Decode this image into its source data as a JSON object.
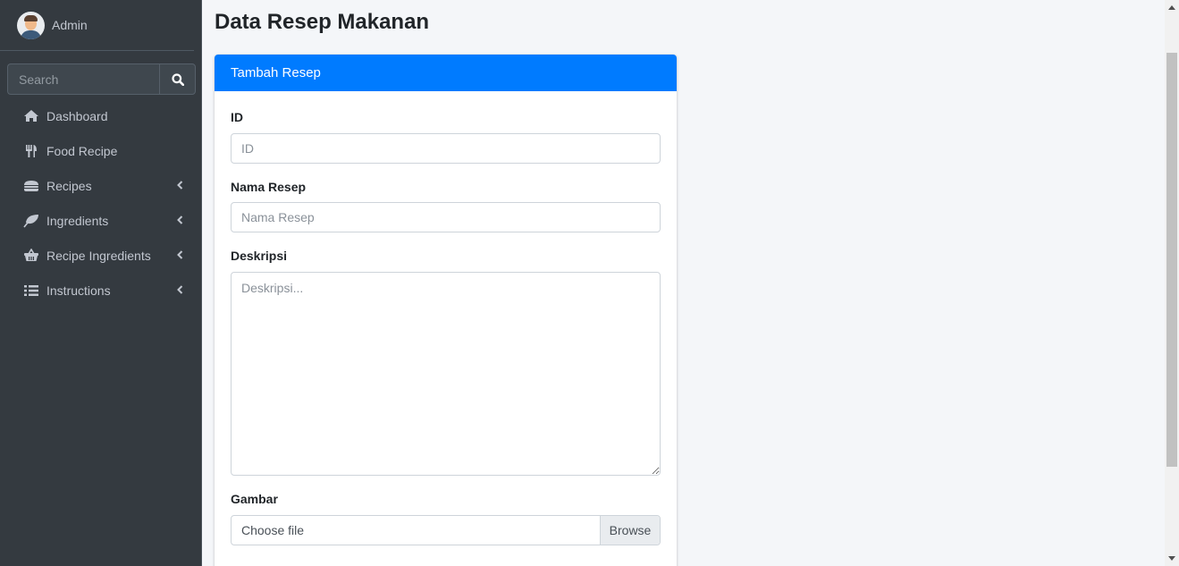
{
  "user": {
    "name": "Admin"
  },
  "search": {
    "placeholder": "Search"
  },
  "nav": [
    {
      "label": "Dashboard",
      "icon": "home-icon",
      "has_submenu": false
    },
    {
      "label": "Food Recipe",
      "icon": "utensils-icon",
      "has_submenu": false
    },
    {
      "label": "Recipes",
      "icon": "hamburger-icon",
      "has_submenu": true
    },
    {
      "label": "Ingredients",
      "icon": "leaf-icon",
      "has_submenu": true
    },
    {
      "label": "Recipe Ingredients",
      "icon": "basket-icon",
      "has_submenu": true
    },
    {
      "label": "Instructions",
      "icon": "list-icon",
      "has_submenu": true
    }
  ],
  "page": {
    "title": "Data Resep Makanan"
  },
  "card": {
    "header": "Tambah Resep"
  },
  "form": {
    "id_label": "ID",
    "id_placeholder": "ID",
    "nama_label": "Nama Resep",
    "nama_placeholder": "Nama Resep",
    "deskripsi_label": "Deskripsi",
    "deskripsi_placeholder": "Deskripsi...",
    "gambar_label": "Gambar",
    "file_label": "Choose file",
    "browse_label": "Browse"
  },
  "colors": {
    "sidebar_bg": "#343a40",
    "primary": "#007bff",
    "content_bg": "#f4f6f9"
  }
}
